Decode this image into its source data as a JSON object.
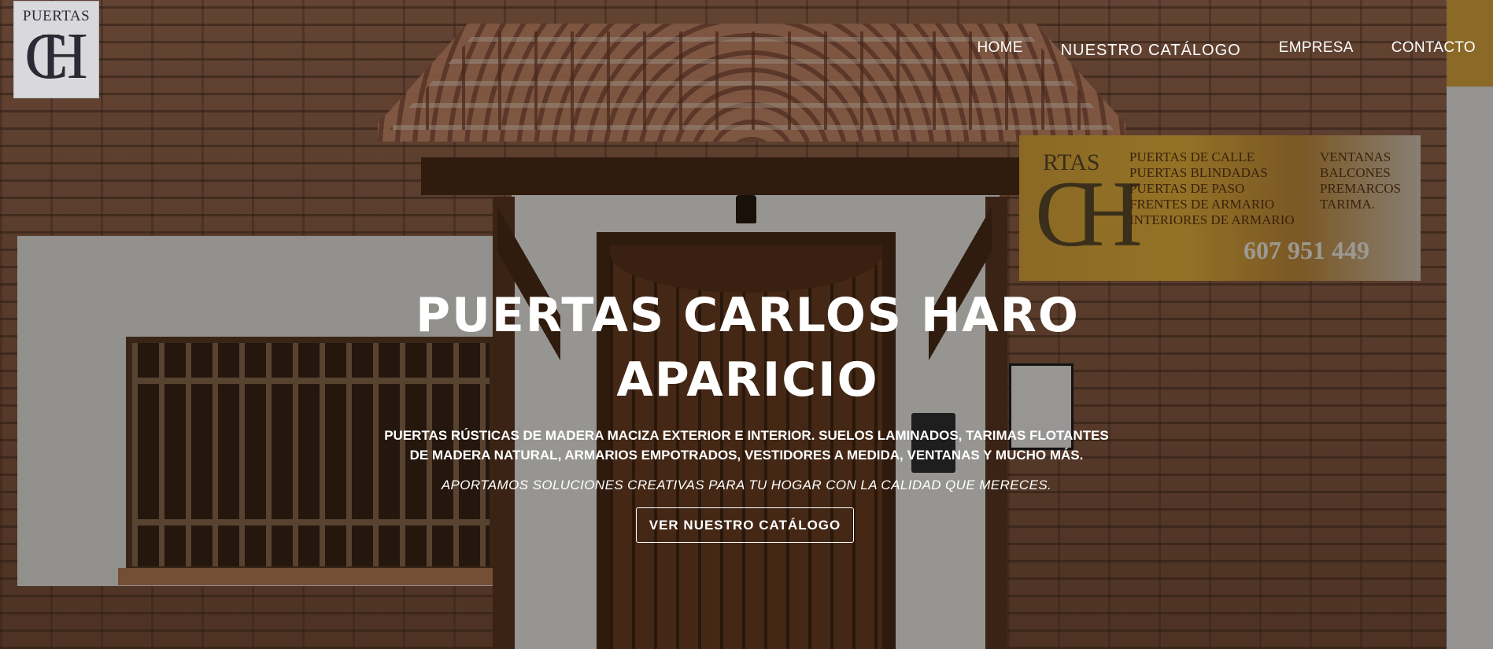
{
  "header": {
    "logo": {
      "text": "PUERTAS",
      "monogram_c": "C",
      "monogram_h": "H"
    },
    "nav": {
      "items": [
        {
          "label": "HOME"
        },
        {
          "label": "NUESTRO CATÁLOGO"
        },
        {
          "label": "EMPRESA"
        },
        {
          "label": "CONTACTO"
        }
      ]
    }
  },
  "hero": {
    "title": "PUERTAS CARLOS HARO APARICIO",
    "subtitle": "PUERTAS RÚSTICAS DE MADERA MACIZA EXTERIOR E INTERIOR. SUELOS LAMINADOS, TARIMAS FLOTANTES DE MADERA NATURAL, ARMARIOS EMPOTRADOS, VESTIDORES A MEDIDA, VENTANAS Y MUCHO MÁS.",
    "tagline": "APORTAMOS SOLUCIONES CREATIVAS PARA TU HOGAR CON LA CALIDAD QUE MERECES.",
    "cta_label": "VER NUESTRO CATÁLOGO"
  },
  "background_sign": {
    "brand": "RTAS",
    "col_a": [
      "PUERTAS DE CALLE",
      "PUERTAS BLINDADAS",
      "PUERTAS DE PASO",
      "FRENTES DE ARMARIO",
      "INTERIORES DE ARMARIO"
    ],
    "col_b": [
      "VENTANAS",
      "BALCONES",
      "PREMARCOS",
      "TARIMA."
    ],
    "phone": "607 951 449"
  },
  "colors": {
    "nav_text": "#ffffff",
    "hero_text": "#ffffff",
    "overlay": "rgba(0,0,0,0.36)",
    "brick": "#8a5d44"
  }
}
